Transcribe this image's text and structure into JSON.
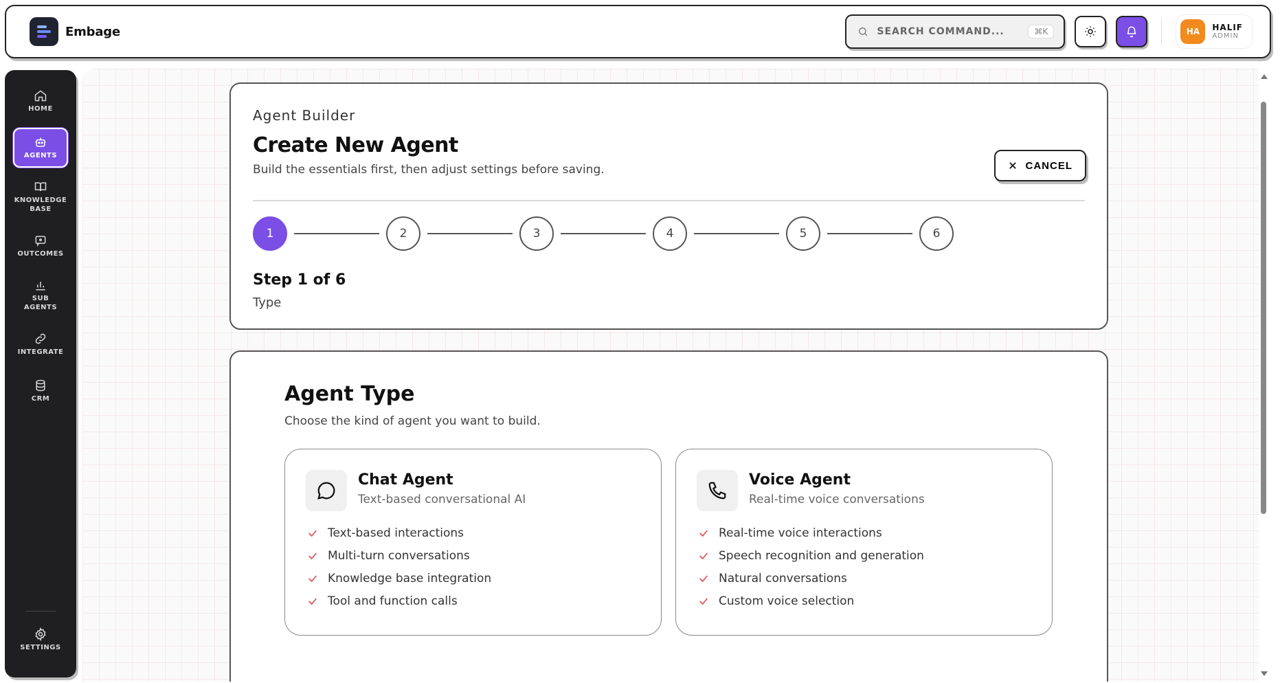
{
  "header": {
    "brand_name": "Embage",
    "search_placeholder": "SEARCH COMMAND...",
    "search_shortcut": "⌘K",
    "user": {
      "initials": "HA",
      "name": "HALIF",
      "role": "ADMIN"
    }
  },
  "sidebar": {
    "items": [
      {
        "label": "HOME",
        "icon": "home-icon"
      },
      {
        "label": "AGENTS",
        "icon": "robot-icon",
        "active": true
      },
      {
        "label": "KNOWLEDGE BASE",
        "icon": "book-icon"
      },
      {
        "label": "OUTCOMES",
        "icon": "chat-bubble-icon"
      },
      {
        "label": "SUB AGENTS",
        "icon": "bar-chart-icon"
      },
      {
        "label": "INTEGRATE",
        "icon": "link-icon"
      },
      {
        "label": "CRM",
        "icon": "database-icon"
      }
    ],
    "settings_label": "SETTINGS"
  },
  "builder": {
    "eyebrow": "Agent Builder",
    "title": "Create New Agent",
    "subtitle": "Build the essentials first, then adjust settings before saving.",
    "cancel_label": "CANCEL",
    "steps": [
      "1",
      "2",
      "3",
      "4",
      "5",
      "6"
    ],
    "current_step": 1,
    "step_title": "Step 1 of 6",
    "step_name": "Type"
  },
  "agent_type": {
    "title": "Agent Type",
    "subtitle": "Choose the kind of agent you want to build.",
    "cards": [
      {
        "title": "Chat Agent",
        "subtitle": "Text-based conversational AI",
        "icon": "chat-icon",
        "features": [
          "Text-based interactions",
          "Multi-turn conversations",
          "Knowledge base integration",
          "Tool and function calls"
        ]
      },
      {
        "title": "Voice Agent",
        "subtitle": "Real-time voice conversations",
        "icon": "phone-icon",
        "features": [
          "Real-time voice interactions",
          "Speech recognition and generation",
          "Natural conversations",
          "Custom voice selection"
        ]
      }
    ]
  },
  "colors": {
    "accent": "#7b4ee6",
    "sidebar_bg": "#1f1f21",
    "check": "#e05050",
    "avatar": "#f28a1e"
  }
}
